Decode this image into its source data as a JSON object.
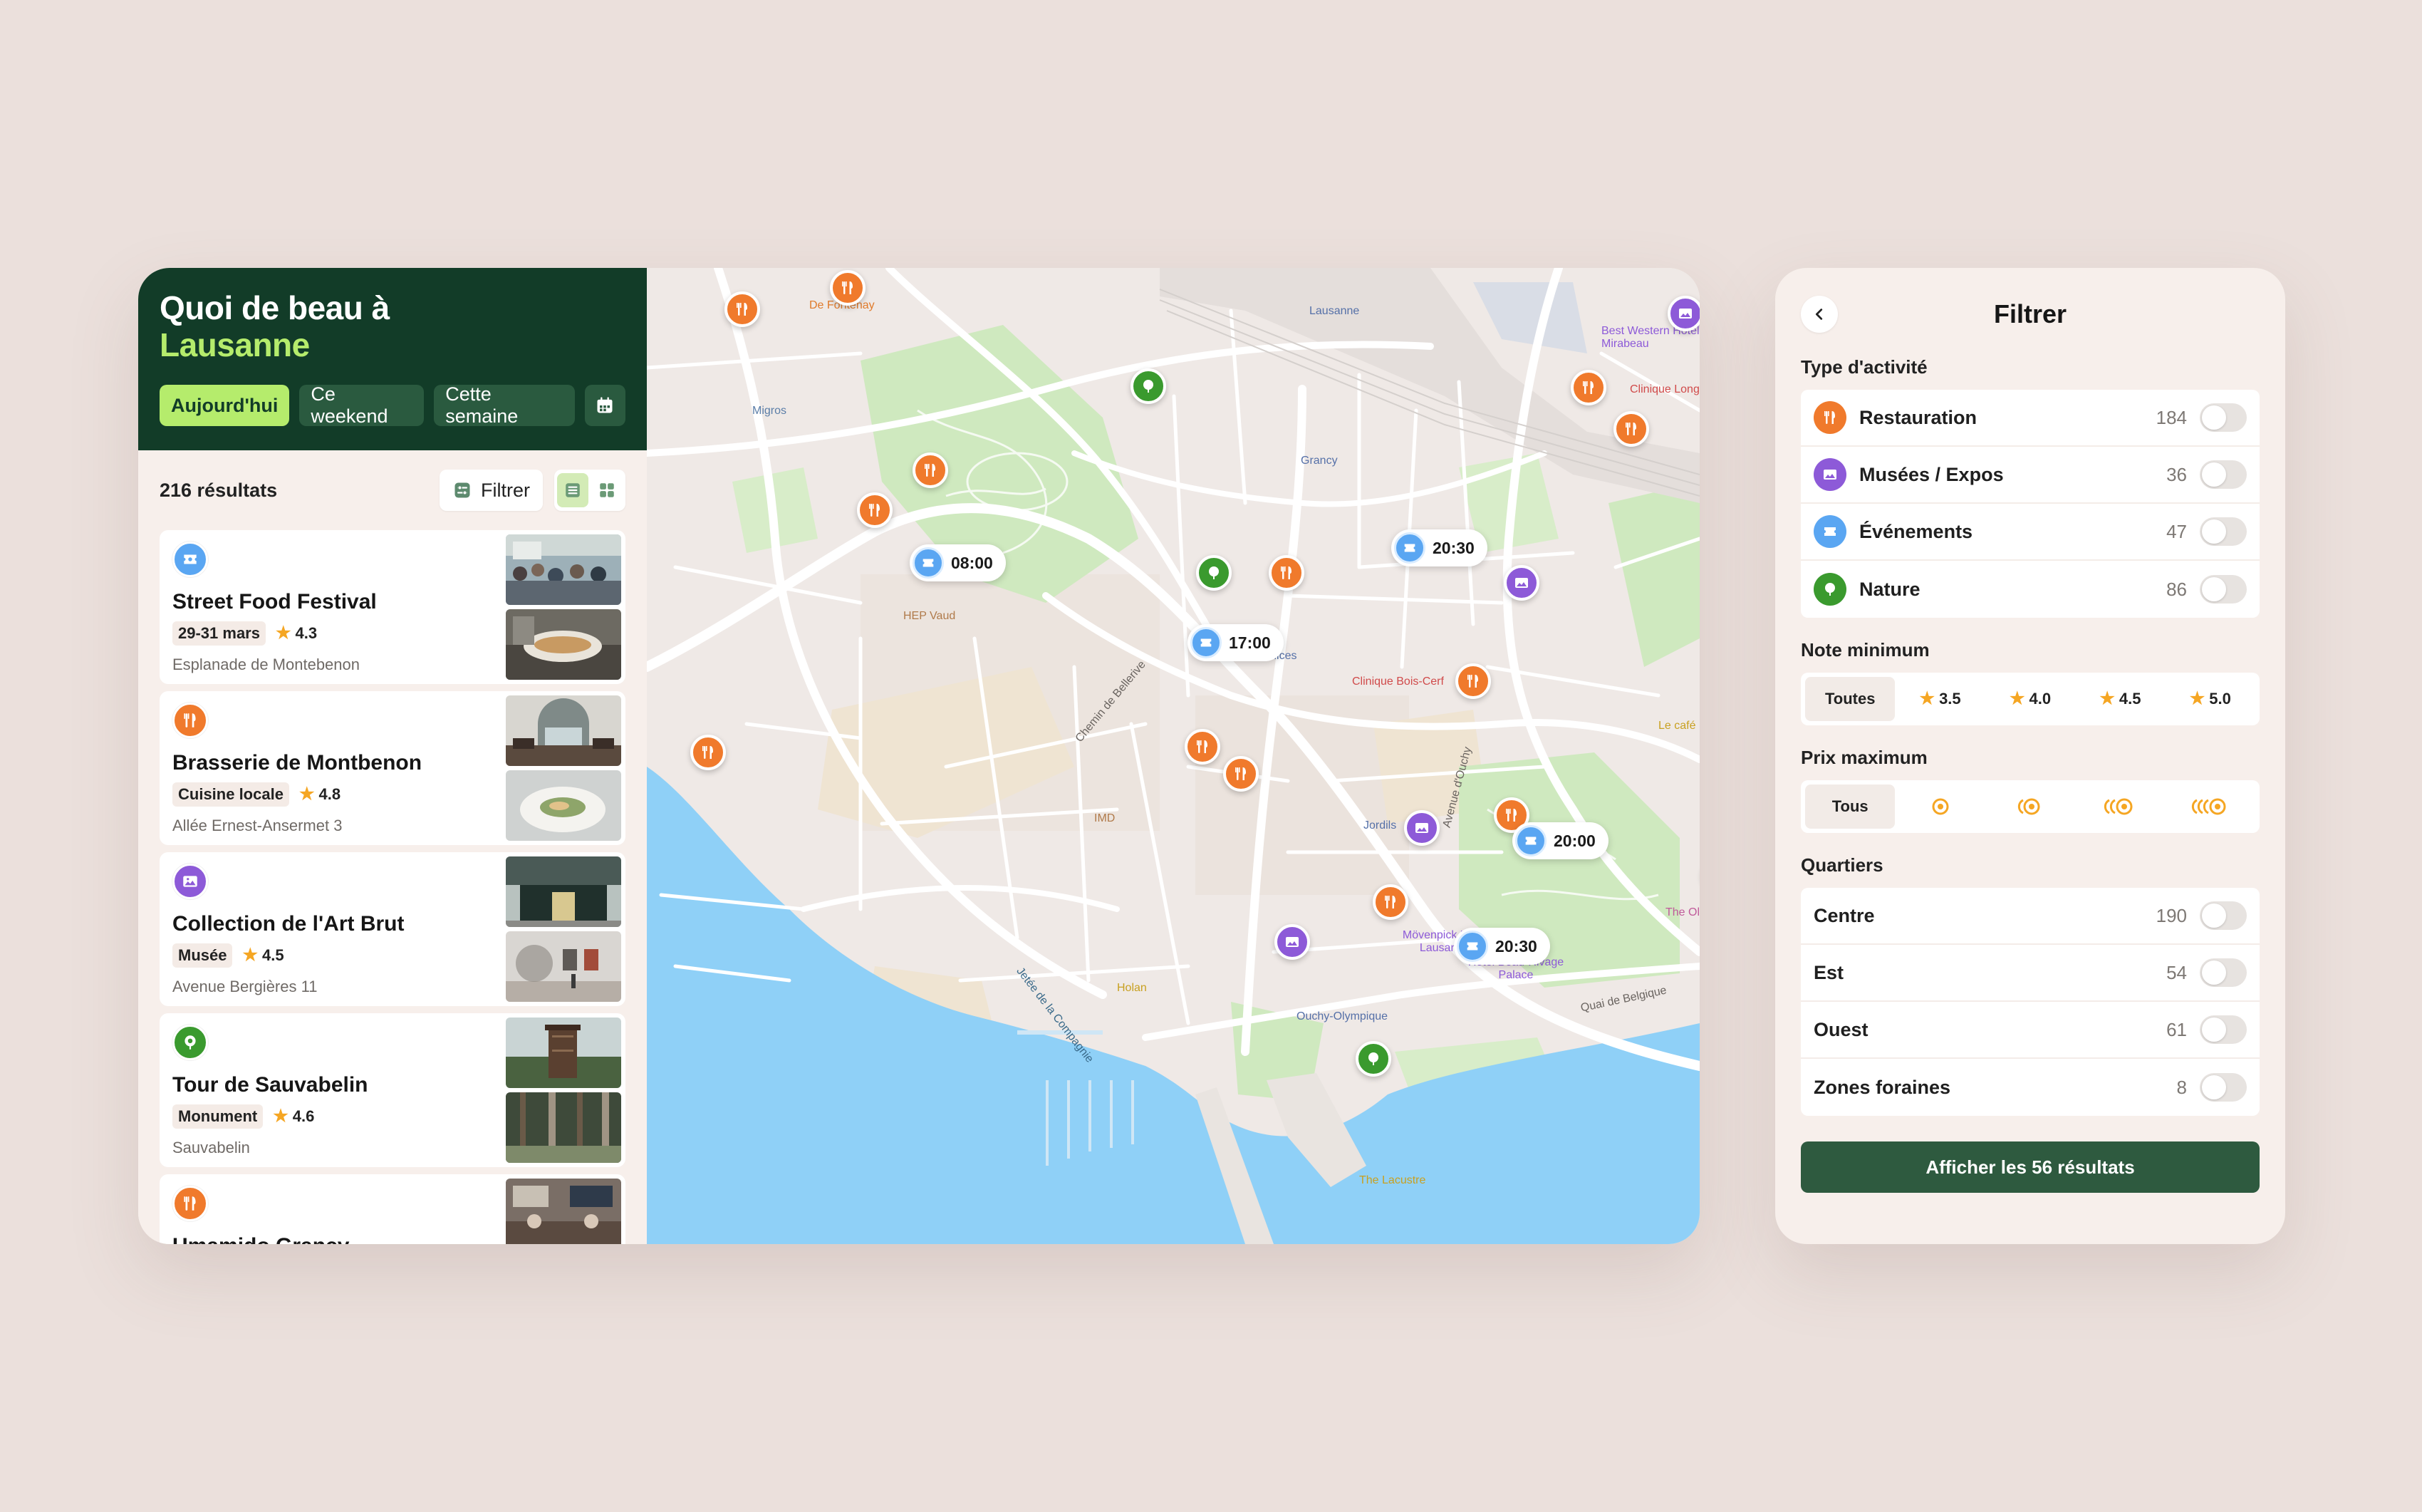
{
  "header": {
    "title_line1": "Quoi de beau à",
    "title_line2": "Lausanne",
    "chips": [
      "Aujourd'hui",
      "Ce weekend",
      "Cette semaine"
    ]
  },
  "results": {
    "count": "216 résultats",
    "filter_label": "Filtrer"
  },
  "items": [
    {
      "name": "Street Food Festival",
      "tag": "29-31 mars",
      "rating": "4.3",
      "address": "Esplanade de Montebenon",
      "category": "event"
    },
    {
      "name": "Brasserie de Montbenon",
      "tag": "Cuisine locale",
      "rating": "4.8",
      "address": "Allée Ernest-Ansermet 3",
      "category": "restaurant"
    },
    {
      "name": "Collection de l'Art Brut",
      "tag": "Musée",
      "rating": "4.5",
      "address": "Avenue Bergières 11",
      "category": "museum"
    },
    {
      "name": "Tour de Sauvabelin",
      "tag": "Monument",
      "rating": "4.6",
      "address": "Sauvabelin",
      "category": "nature"
    },
    {
      "name": "Umamido Grancy",
      "category": "restaurant"
    }
  ],
  "map": {
    "labels": [
      "De Fontenay",
      "Lausanne",
      "Best Western Hotel Mirabeau",
      "Clinique Longeraie",
      "Migros",
      "Grancy",
      "HEP Vaud",
      "Délices",
      "Clinique Bois-Cerf",
      "Chemin de Bellerive",
      "Avenue d'Ouchy",
      "Jordils",
      "IMD",
      "Le café",
      "The Olympic Museum",
      "Mövenpick Hotel Lausanne",
      "Hôtel Beau-Rivage Palace",
      "Quai de Belgique",
      "Jetée de la Compagnie",
      "Ouchy-Olympique",
      "Holan",
      "The Lacustre"
    ],
    "time_pins": [
      "08:00",
      "20:30",
      "17:00",
      "20:00",
      "20:30"
    ]
  },
  "filter": {
    "title": "Filtrer",
    "activity_title": "Type d'activité",
    "activities": [
      {
        "label": "Restauration",
        "count": "184",
        "icon": "utensils-icon"
      },
      {
        "label": "Musées / Expos",
        "count": "36",
        "icon": "picture-icon"
      },
      {
        "label": "Événements",
        "count": "47",
        "icon": "ticket-icon"
      },
      {
        "label": "Nature",
        "count": "86",
        "icon": "tree-icon"
      }
    ],
    "rating_title": "Note minimum",
    "ratings": [
      "Toutes",
      "3.5",
      "4.0",
      "4.5",
      "5.0"
    ],
    "price_title": "Prix maximum",
    "price_all": "Tous",
    "district_title": "Quartiers",
    "districts": [
      {
        "label": "Centre",
        "count": "190"
      },
      {
        "label": "Est",
        "count": "54"
      },
      {
        "label": "Ouest",
        "count": "61"
      },
      {
        "label": "Zones foraines",
        "count": "8"
      }
    ],
    "cta": "Afficher les 56 résultats"
  },
  "colors": {
    "restaurant": "#f07a2c",
    "museum": "#8d5ad8",
    "event": "#5aa6f2",
    "nature": "#3a9a2e",
    "header_bg": "#123c28",
    "accent": "#b5ec6c",
    "water": "#8fd0f7",
    "park": "#cfe9bf"
  }
}
